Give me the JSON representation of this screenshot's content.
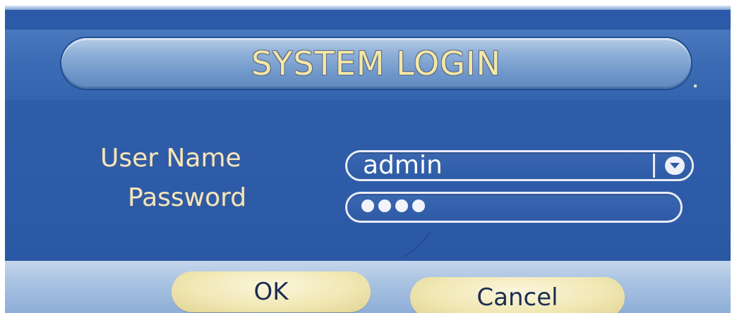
{
  "dialog": {
    "title": "SYSTEM LOGIN"
  },
  "form": {
    "username_label": "User Name",
    "username_value": "admin",
    "password_label": "Password",
    "password_mask_count": 4
  },
  "buttons": {
    "ok_label": "OK",
    "cancel_label": "Cancel"
  },
  "colors": {
    "panel": "#2d5aa8",
    "title_text": "#f3e7a6",
    "label_text": "#f0e6c2",
    "button_fill": "#f1e8b5",
    "button_text": "#1c2d52"
  },
  "icons": {
    "dropdown": "chevron-down-icon"
  }
}
